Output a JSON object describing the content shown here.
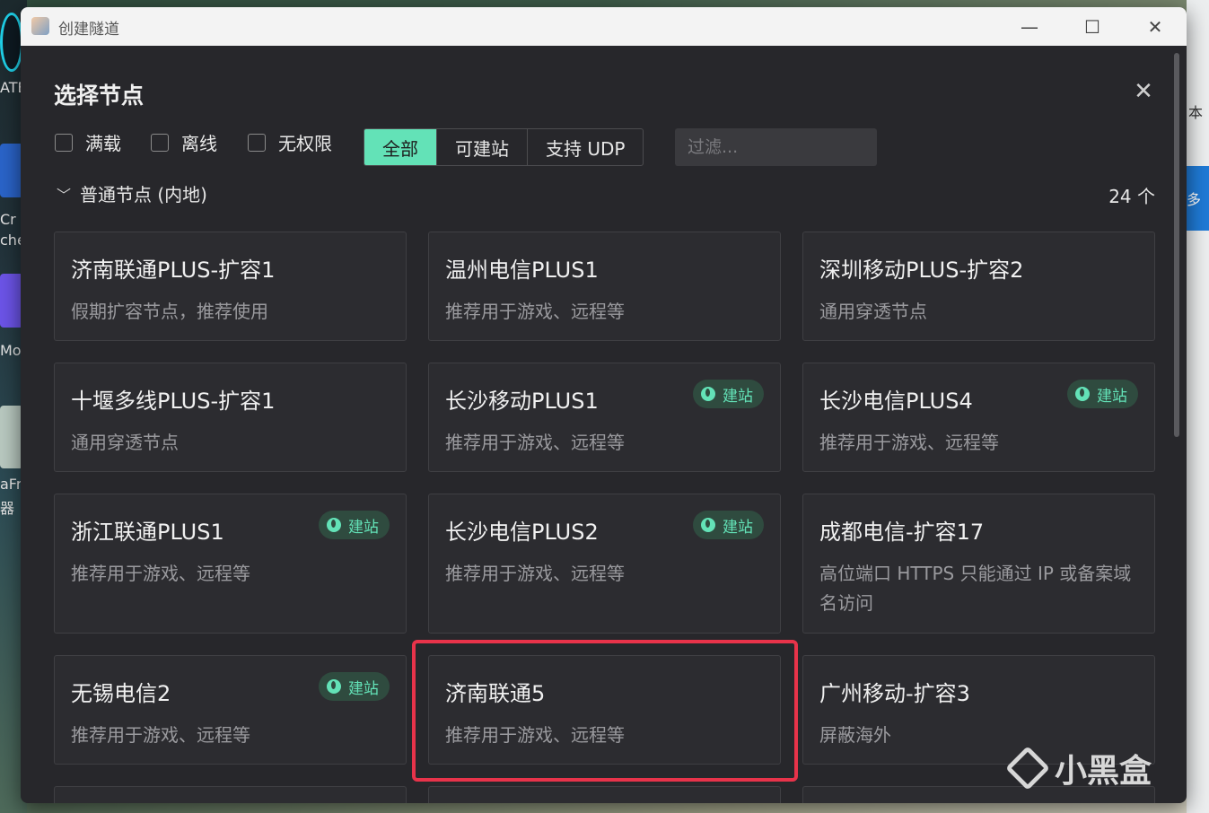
{
  "window": {
    "title": "创建隧道",
    "controls": [
      "—",
      "☐",
      "✕"
    ]
  },
  "desktop_left_texts": [
    "ATE",
    "Cr",
    "che",
    "Mo",
    "aFr",
    "器"
  ],
  "desktop_right_texts": [
    "本",
    "多"
  ],
  "panel": {
    "heading": "选择节点",
    "close": "✕",
    "checkboxes": [
      "满载",
      "离线",
      "无权限"
    ],
    "segments": [
      "全部",
      "可建站",
      "支持 UDP"
    ],
    "active_segment": "全部",
    "filter_placeholder": "过滤...",
    "group": {
      "chevron": "﹀",
      "label": "普通节点 (内地)",
      "count": "24 个"
    }
  },
  "badge_label": "建站",
  "nodes": [
    {
      "name": "济南联通PLUS-扩容1",
      "desc": "假期扩容节点，推荐使用",
      "site": false
    },
    {
      "name": "温州电信PLUS1",
      "desc": "推荐用于游戏、远程等",
      "site": false
    },
    {
      "name": "深圳移动PLUS-扩容2",
      "desc": "通用穿透节点",
      "site": false
    },
    {
      "name": "十堰多线PLUS-扩容1",
      "desc": "通用穿透节点",
      "site": false
    },
    {
      "name": "长沙移动PLUS1",
      "desc": "推荐用于游戏、远程等",
      "site": true
    },
    {
      "name": "长沙电信PLUS4",
      "desc": "推荐用于游戏、远程等",
      "site": true
    },
    {
      "name": "浙江联通PLUS1",
      "desc": "推荐用于游戏、远程等",
      "site": true
    },
    {
      "name": "长沙电信PLUS2",
      "desc": "推荐用于游戏、远程等",
      "site": true
    },
    {
      "name": "成都电信-扩容17",
      "desc": "高位端口 HTTPS 只能通过 IP 或备案域名访问",
      "site": false
    },
    {
      "name": "无锡电信2",
      "desc": "推荐用于游戏、远程等",
      "site": true
    },
    {
      "name": "济南联通5",
      "desc": "推荐用于游戏、远程等",
      "site": false
    },
    {
      "name": "广州移动-扩容3",
      "desc": "屏蔽海外",
      "site": false
    }
  ],
  "watermark": "小黑盒",
  "colors": {
    "accent": "#63e2b7",
    "highlight": "#e8334a",
    "panel_bg": "#27272b"
  }
}
